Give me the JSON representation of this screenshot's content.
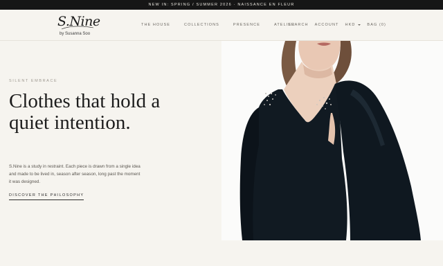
{
  "announcement": "NEW IN: SPRING / SUMMER 2026 · NAISSANCE EN FLEUR",
  "brand": {
    "script": "S.Nine",
    "byline": "by Susanna Soo"
  },
  "nav": [
    {
      "label": "THE HOUSE"
    },
    {
      "label": "COLLECTIONS"
    },
    {
      "label": "PRESENCE"
    },
    {
      "label": "ATELIER"
    }
  ],
  "utility": {
    "search": "SEARCH",
    "account": "ACCOUNT",
    "currency": "HKD",
    "bag": "BAG (0)"
  },
  "hero": {
    "eyebrow": "SILENT EMBRACE",
    "headline": "Clothes that hold a quiet intention.",
    "body": "S.Nine is a study in restraint. Each piece is drawn from a single idea and made to be lived in, season after season, long past the moment it was designed.",
    "cta": "DISCOVER THE PHILOSOPHY"
  },
  "colors": {
    "announcement_bg": "#161616",
    "page_bg": "#f6f4ef",
    "garment": "#101820",
    "text_muted": "#6a6660"
  }
}
